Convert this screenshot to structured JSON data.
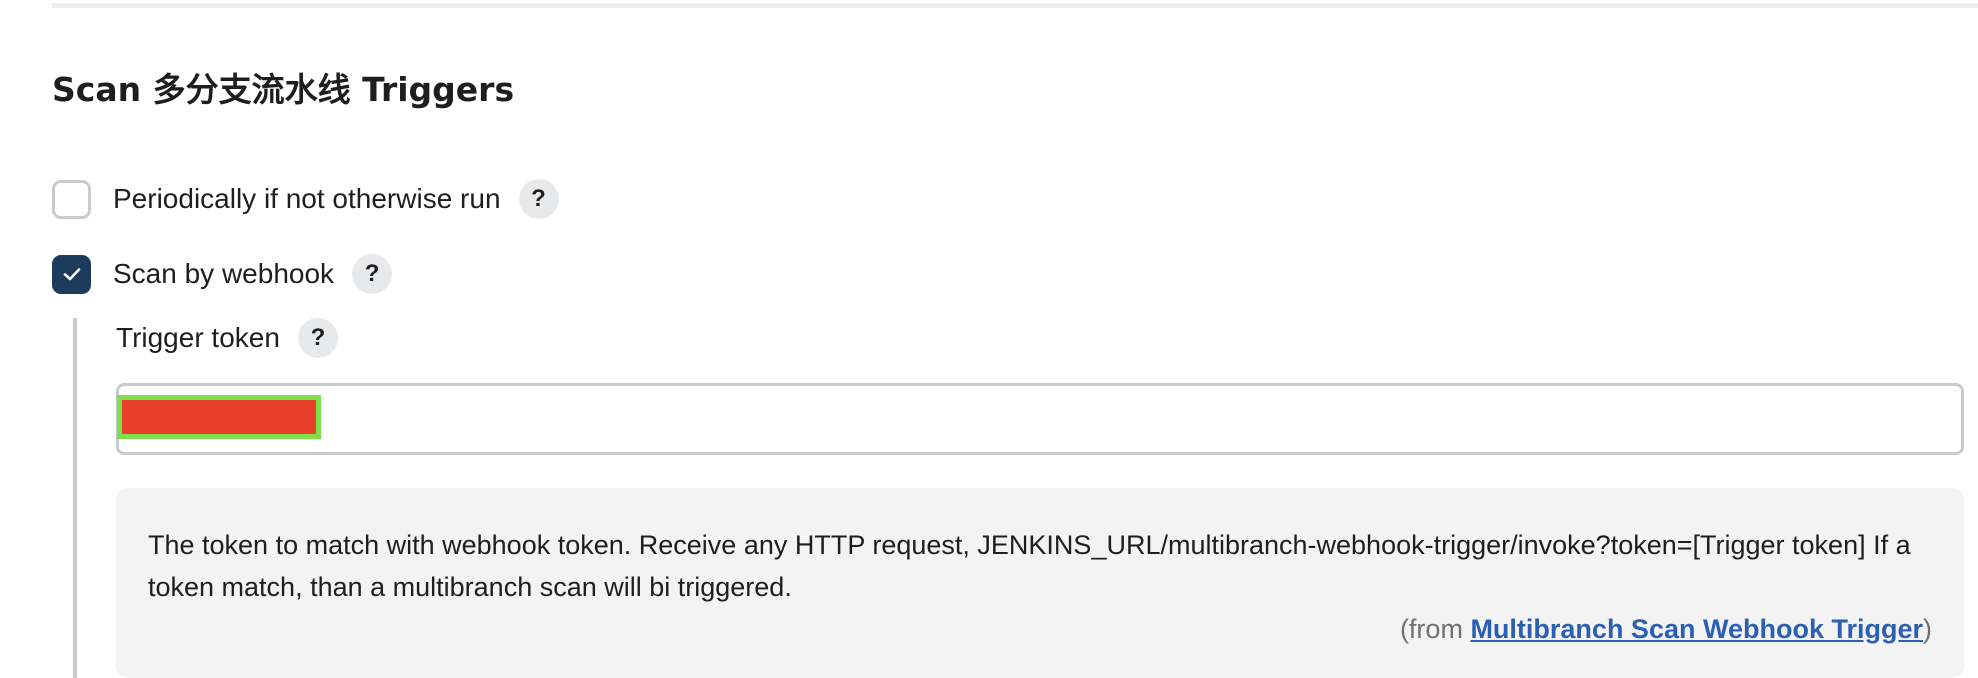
{
  "section": {
    "title": "Scan 多分支流水线 Triggers"
  },
  "triggers": [
    {
      "label": "Periodically if not otherwise run",
      "checked": false,
      "help": "?"
    },
    {
      "label": "Scan by webhook",
      "checked": true,
      "help": "?"
    }
  ],
  "trigger_token": {
    "label": "Trigger token",
    "help": "?",
    "value": ""
  },
  "help_box": {
    "text": "The token to match with webhook token. Receive any HTTP request, JENKINS_URL/multibranch-webhook-trigger/invoke?token=[Trigger token] If a token match, than a multibranch scan will bi triggered.",
    "from_prefix": "(from ",
    "from_link": "Multibranch Scan Webhook Trigger",
    "from_suffix": ")"
  },
  "colors": {
    "checkbox_checked": "#1d3c5c",
    "link": "#2b5fb4",
    "redaction_fill": "#e8402a",
    "redaction_border": "#7ee04a"
  },
  "icons": [
    "checkmark-icon",
    "help-icon"
  ]
}
